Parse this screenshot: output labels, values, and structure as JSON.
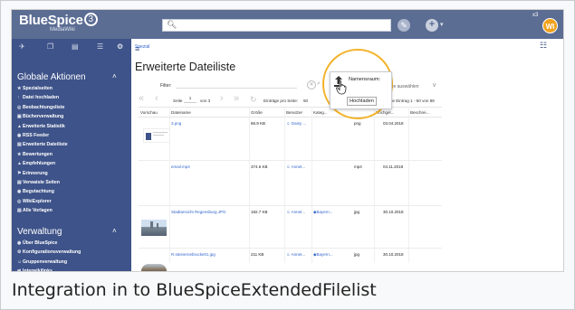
{
  "caption": "Integration in to BlueSpiceExtendedFilelist",
  "header": {
    "logo_main": "BlueSpice",
    "logo_three": "3",
    "logo_sub": "MediaWiki",
    "search_icon": "search-icon",
    "user_initials": "WI",
    "close_mark": "x3"
  },
  "sidebar": {
    "section1_title": "Globale Aktionen",
    "section1_items": [
      "Spezialseiten",
      "Datei hochladen",
      "Beobachtungsliste",
      "Bücherverwaltung",
      "Erweiterte Statistik",
      "RSS Feeder",
      "Erweiterte Dateiliste",
      "Bewertungen",
      "Empfehlungen",
      "Erinnerung",
      "Verwaiste Seiten",
      "Begutachtung",
      "WikiExplorer",
      "Alle Vorlagen"
    ],
    "section2_title": "Verwaltung",
    "section2_items": [
      "Über BlueSpice",
      "Konfigurationsverwaltung",
      "Gruppenverwaltung",
      "Interwikilinks"
    ]
  },
  "breadcrumb": "Spezial",
  "page_title": "Erweiterte Dateiliste",
  "filter": {
    "label": "Filter:",
    "column_select": "...alte auswählen"
  },
  "pager": {
    "page_label": "Seite",
    "page_value": "1",
    "page_of": "von 3",
    "per_page_label": "Einträge pro Seite:",
    "per_page_value": "50",
    "display_info": "...ge Eintrag 1 - 50 von 88"
  },
  "table": {
    "headers": [
      "Vorschau",
      "Dateiname",
      "Größe",
      "Benutzer",
      "Kateg...",
      "",
      "Hochgel...",
      "Beschrei..."
    ],
    "rows": [
      {
        "name": "3.png",
        "size": "86.9 KB",
        "user": "Daisy ...",
        "cat": "",
        "type": "png",
        "date": "03.04.2018"
      },
      {
        "name": "email.mp4",
        "size": "374.6 KB",
        "user": "Annet...",
        "cat": "",
        "type": "mp4",
        "date": "04.11.2018"
      },
      {
        "name": "Stadtansicht Regensburg.JPG",
        "size": "182.7 KB",
        "user": "Annet...",
        "cat": "Bayern...",
        "type": "jpg",
        "date": "30.10.2018"
      },
      {
        "name": "R.steinernebrucke01.jpg",
        "size": "211 KB",
        "user": "Annet...",
        "cat": "Bayern...",
        "type": "jpg",
        "date": "30.10.2018"
      }
    ]
  },
  "popup": {
    "namespace_label": "Namensraum:",
    "upload_button": "Hochladen"
  },
  "colors": {
    "header": "#5b6d93",
    "sidebar": "#3e5389",
    "highlight": "#f3b229",
    "link": "#3366cc"
  }
}
